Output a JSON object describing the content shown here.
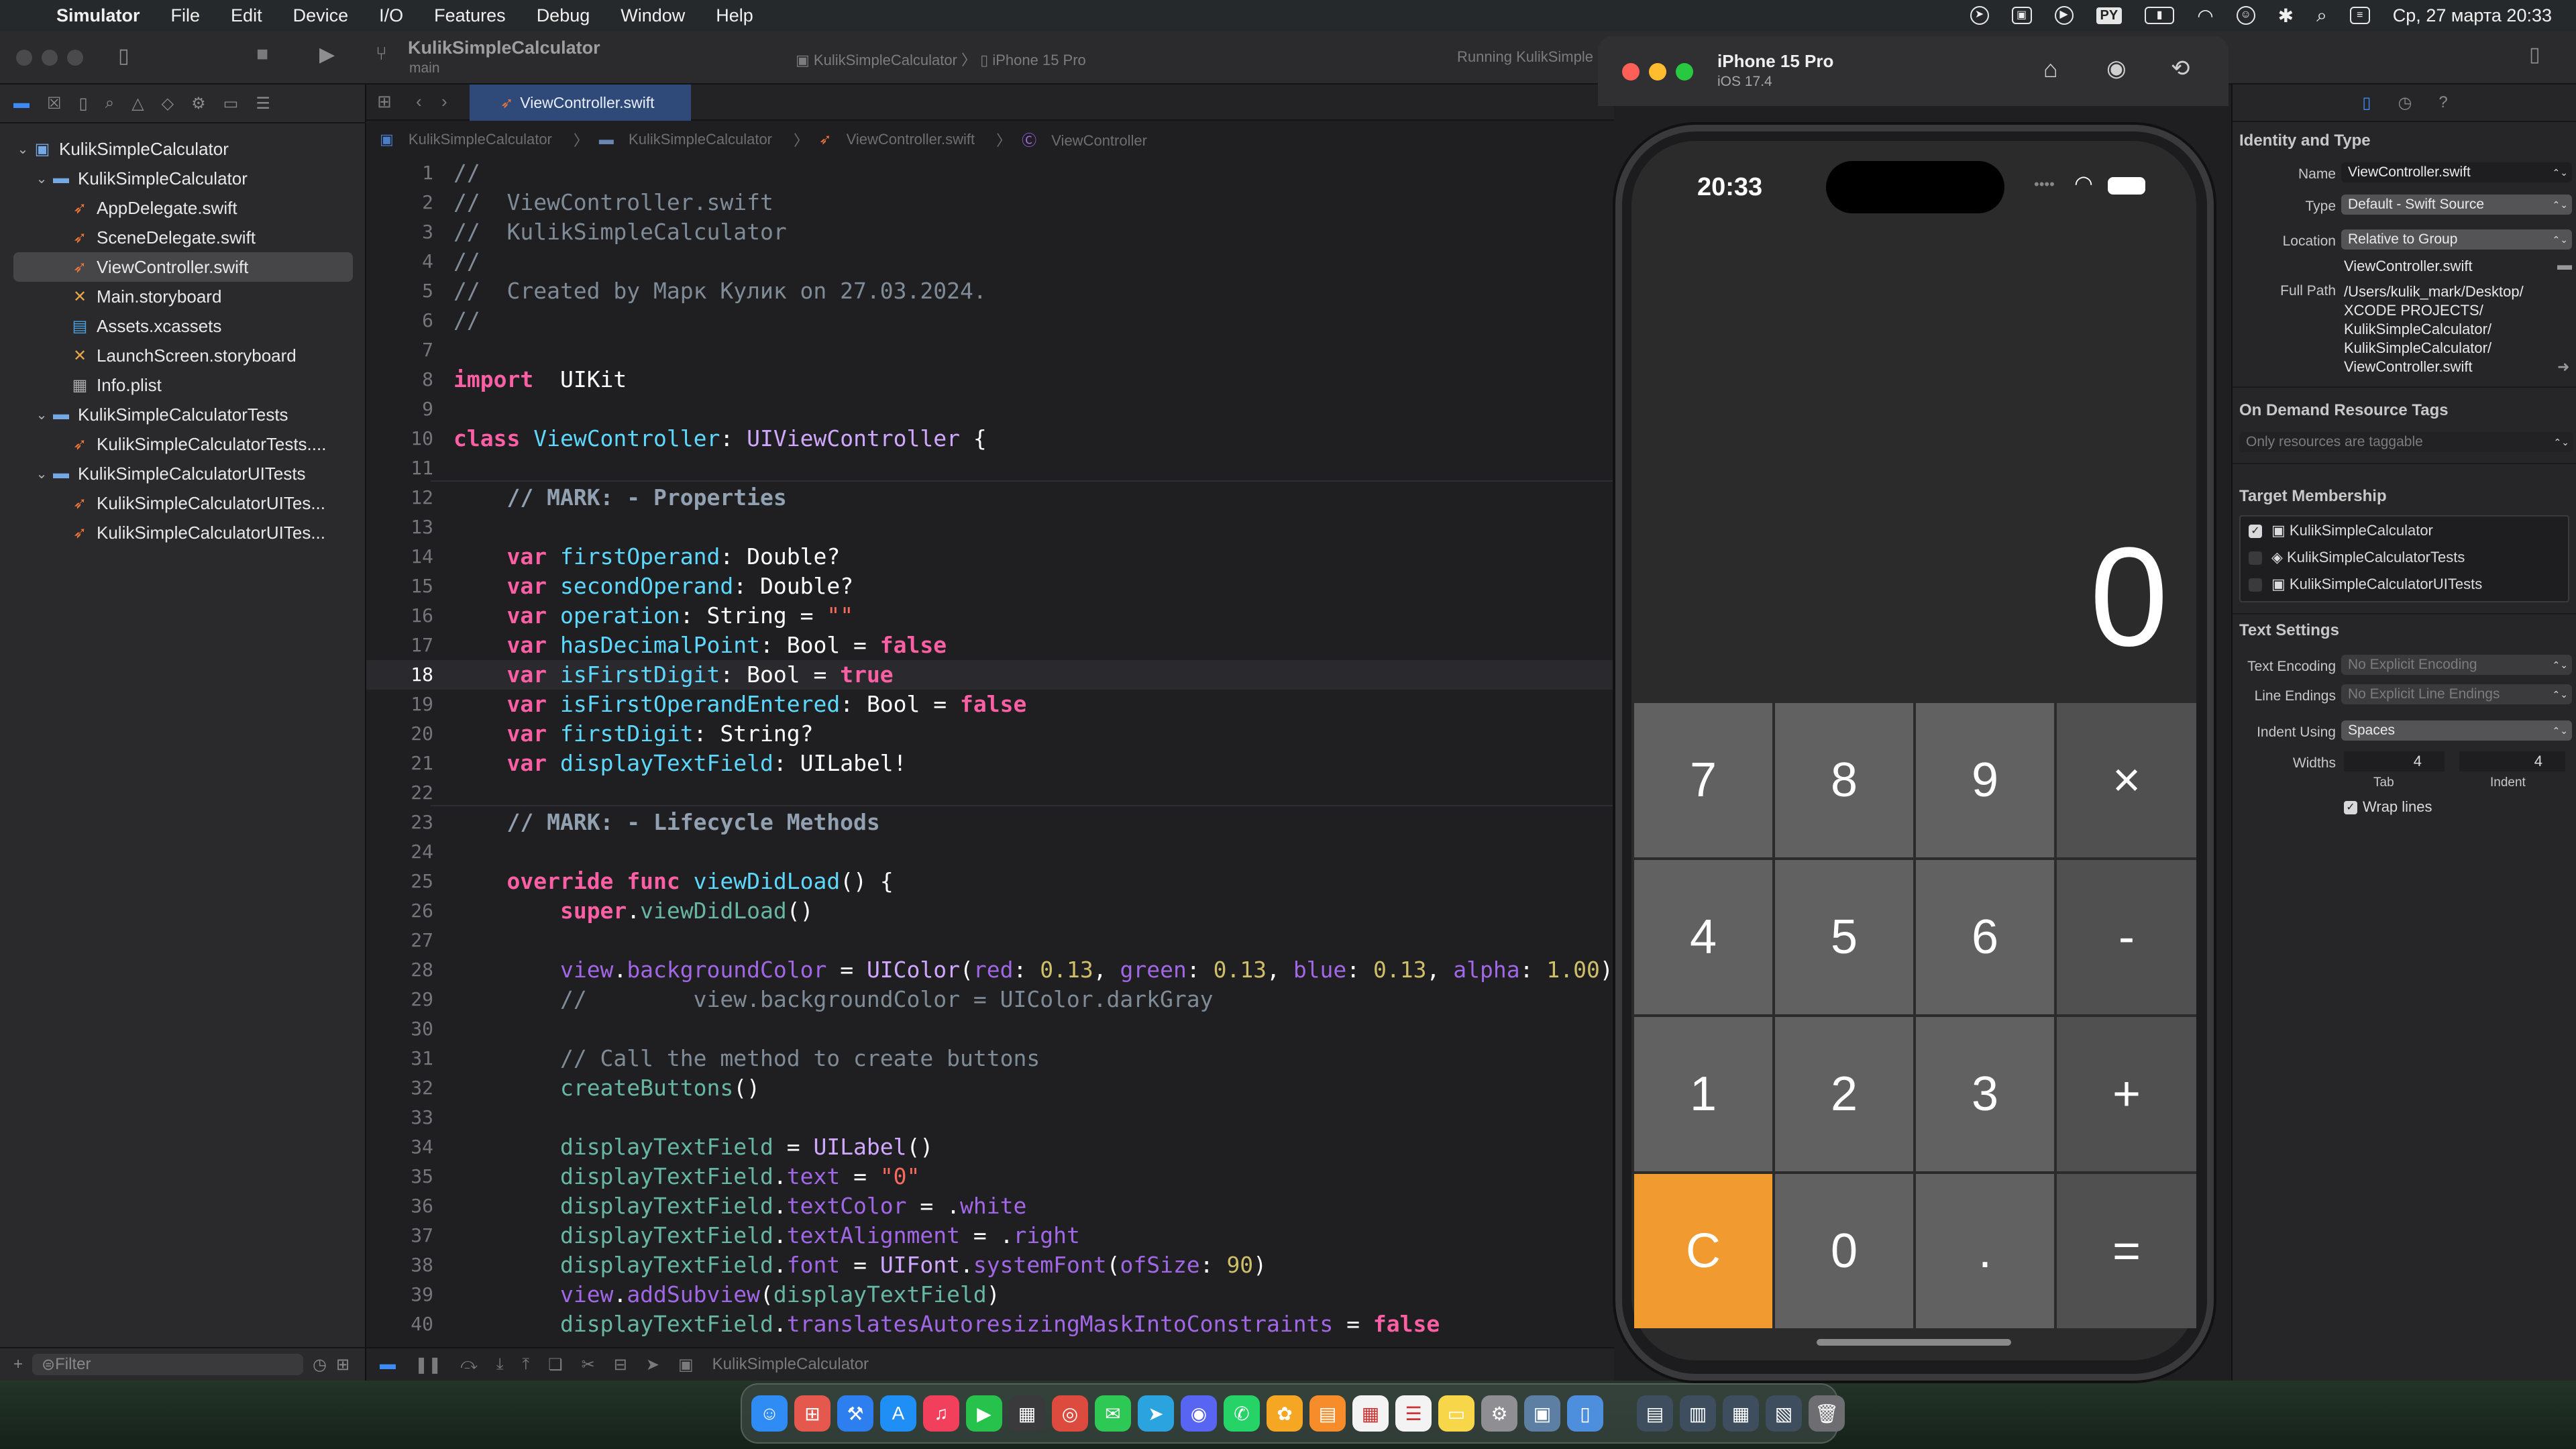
{
  "menubar": {
    "app": "Simulator",
    "items": [
      "File",
      "Edit",
      "Device",
      "I/O",
      "Features",
      "Debug",
      "Window",
      "Help"
    ],
    "lang": "PY",
    "datetime": "Ср, 27 марта 20:33"
  },
  "toolbar": {
    "project": "KulikSimpleCalculator",
    "branch": "main",
    "scheme": "KulikSimpleCalculator",
    "destination": "iPhone 15 Pro",
    "status": "Running KulikSimple"
  },
  "navigator": {
    "items": [
      {
        "label": "KulikSimpleCalculator",
        "indent": 0,
        "kind": "project",
        "chevron": "v"
      },
      {
        "label": "KulikSimpleCalculator",
        "indent": 1,
        "kind": "folder",
        "chevron": "v"
      },
      {
        "label": "AppDelegate.swift",
        "indent": 2,
        "kind": "swift"
      },
      {
        "label": "SceneDelegate.swift",
        "indent": 2,
        "kind": "swift"
      },
      {
        "label": "ViewController.swift",
        "indent": 2,
        "kind": "swift",
        "selected": true
      },
      {
        "label": "Main.storyboard",
        "indent": 2,
        "kind": "sb"
      },
      {
        "label": "Assets.xcassets",
        "indent": 2,
        "kind": "assets"
      },
      {
        "label": "LaunchScreen.storyboard",
        "indent": 2,
        "kind": "sb"
      },
      {
        "label": "Info.plist",
        "indent": 2,
        "kind": "plist"
      },
      {
        "label": "KulikSimpleCalculatorTests",
        "indent": 1,
        "kind": "folder",
        "chevron": "v"
      },
      {
        "label": "KulikSimpleCalculatorTests....",
        "indent": 2,
        "kind": "swift"
      },
      {
        "label": "KulikSimpleCalculatorUITests",
        "indent": 1,
        "kind": "folder",
        "chevron": "v"
      },
      {
        "label": "KulikSimpleCalculatorUITes...",
        "indent": 2,
        "kind": "swift"
      },
      {
        "label": "KulikSimpleCalculatorUITes...",
        "indent": 2,
        "kind": "swift"
      }
    ],
    "filter_placeholder": "Filter"
  },
  "editor": {
    "tab": "ViewController.swift",
    "jump": [
      "KulikSimpleCalculator",
      "KulikSimpleCalculator",
      "ViewController.swift",
      "ViewController"
    ],
    "current_line": 18,
    "lines": [
      [
        [
          "cm",
          "//"
        ]
      ],
      [
        [
          "cm",
          "//  ViewController.swift"
        ]
      ],
      [
        [
          "cm",
          "//  KulikSimpleCalculator"
        ]
      ],
      [
        [
          "cm",
          "//"
        ]
      ],
      [
        [
          "cm",
          "//  Created by Марк Кулик on 27.03.2024."
        ]
      ],
      [
        [
          "cm",
          "//"
        ]
      ],
      [],
      [
        [
          "kw",
          "import"
        ],
        [
          "",
          "  UIKit"
        ]
      ],
      [],
      [
        [
          "kw",
          "class"
        ],
        [
          "",
          " "
        ],
        [
          "dcl",
          "ViewController"
        ],
        [
          "",
          ": "
        ],
        [
          "ty",
          "UIViewController"
        ],
        [
          "",
          " {"
        ]
      ],
      [],
      [
        [
          "",
          "    "
        ],
        [
          "cmk",
          "// MARK: - Properties"
        ]
      ],
      [],
      [
        [
          "",
          "    "
        ],
        [
          "kw",
          "var"
        ],
        [
          "",
          " "
        ],
        [
          "dcl",
          "firstOperand"
        ],
        [
          "",
          ": Double?"
        ]
      ],
      [
        [
          "",
          "    "
        ],
        [
          "kw",
          "var"
        ],
        [
          "",
          " "
        ],
        [
          "dcl",
          "secondOperand"
        ],
        [
          "",
          ": Double?"
        ]
      ],
      [
        [
          "",
          "    "
        ],
        [
          "kw",
          "var"
        ],
        [
          "",
          " "
        ],
        [
          "dcl",
          "operation"
        ],
        [
          "",
          ": String = "
        ],
        [
          "st",
          "\"\""
        ]
      ],
      [
        [
          "",
          "    "
        ],
        [
          "kw",
          "var"
        ],
        [
          "",
          " "
        ],
        [
          "dcl",
          "hasDecimalPoint"
        ],
        [
          "",
          ": Bool = "
        ],
        [
          "kw",
          "false"
        ]
      ],
      [
        [
          "",
          "    "
        ],
        [
          "kw",
          "var"
        ],
        [
          "",
          " "
        ],
        [
          "dcl",
          "isFirstDigit"
        ],
        [
          "",
          ": Bool = "
        ],
        [
          "kw",
          "true"
        ]
      ],
      [
        [
          "",
          "    "
        ],
        [
          "kw",
          "var"
        ],
        [
          "",
          " "
        ],
        [
          "dcl",
          "isFirstOperandEntered"
        ],
        [
          "",
          ": Bool = "
        ],
        [
          "kw",
          "false"
        ]
      ],
      [
        [
          "",
          "    "
        ],
        [
          "kw",
          "var"
        ],
        [
          "",
          " "
        ],
        [
          "dcl",
          "firstDigit"
        ],
        [
          "",
          ": String?"
        ]
      ],
      [
        [
          "",
          "    "
        ],
        [
          "kw",
          "var"
        ],
        [
          "",
          " "
        ],
        [
          "dcl",
          "displayTextField"
        ],
        [
          "",
          ": UILabel!"
        ]
      ],
      [],
      [
        [
          "",
          "    "
        ],
        [
          "cmk",
          "// MARK: - Lifecycle Methods"
        ]
      ],
      [],
      [
        [
          "",
          "    "
        ],
        [
          "kw",
          "override"
        ],
        [
          "",
          " "
        ],
        [
          "kw",
          "func"
        ],
        [
          "",
          " "
        ],
        [
          "dcl",
          "viewDidLoad"
        ],
        [
          "",
          "() {"
        ]
      ],
      [
        [
          "",
          "        "
        ],
        [
          "kw",
          "super"
        ],
        [
          "",
          "."
        ],
        [
          "fn",
          "viewDidLoad"
        ],
        [
          "",
          "()"
        ]
      ],
      [],
      [
        [
          "",
          "        "
        ],
        [
          "pr",
          "view"
        ],
        [
          "",
          "."
        ],
        [
          "pr",
          "backgroundColor"
        ],
        [
          "",
          " = "
        ],
        [
          "ty",
          "UIColor"
        ],
        [
          "",
          "("
        ],
        [
          "pr",
          "red"
        ],
        [
          "",
          ": "
        ],
        [
          "nu",
          "0.13"
        ],
        [
          "",
          ", "
        ],
        [
          "pr",
          "green"
        ],
        [
          "",
          ": "
        ],
        [
          "nu",
          "0.13"
        ],
        [
          "",
          ", "
        ],
        [
          "pr",
          "blue"
        ],
        [
          "",
          ": "
        ],
        [
          "nu",
          "0.13"
        ],
        [
          "",
          ", "
        ],
        [
          "pr",
          "alpha"
        ],
        [
          "",
          ": "
        ],
        [
          "nu",
          "1.00"
        ],
        [
          "",
          ")"
        ]
      ],
      [
        [
          "",
          "        "
        ],
        [
          "cm",
          "//        view.backgroundColor = UIColor.darkGray"
        ]
      ],
      [],
      [
        [
          "",
          "        "
        ],
        [
          "cm",
          "// Call the method to create buttons"
        ]
      ],
      [
        [
          "",
          "        "
        ],
        [
          "fn",
          "createButtons"
        ],
        [
          "",
          "()"
        ]
      ],
      [],
      [
        [
          "",
          "        "
        ],
        [
          "fn",
          "displayTextField"
        ],
        [
          "",
          " = "
        ],
        [
          "ty",
          "UILabel"
        ],
        [
          "",
          "()"
        ]
      ],
      [
        [
          "",
          "        "
        ],
        [
          "fn",
          "displayTextField"
        ],
        [
          "",
          "."
        ],
        [
          "pr",
          "text"
        ],
        [
          "",
          " = "
        ],
        [
          "st",
          "\"0\""
        ]
      ],
      [
        [
          "",
          "        "
        ],
        [
          "fn",
          "displayTextField"
        ],
        [
          "",
          "."
        ],
        [
          "pr",
          "textColor"
        ],
        [
          "",
          " = ."
        ],
        [
          "pr",
          "white"
        ]
      ],
      [
        [
          "",
          "        "
        ],
        [
          "fn",
          "displayTextField"
        ],
        [
          "",
          "."
        ],
        [
          "pr",
          "textAlignment"
        ],
        [
          "",
          " = ."
        ],
        [
          "pr",
          "right"
        ]
      ],
      [
        [
          "",
          "        "
        ],
        [
          "fn",
          "displayTextField"
        ],
        [
          "",
          "."
        ],
        [
          "pr",
          "font"
        ],
        [
          "",
          " = "
        ],
        [
          "ty",
          "UIFont"
        ],
        [
          "",
          "."
        ],
        [
          "pr",
          "systemFont"
        ],
        [
          "",
          "("
        ],
        [
          "pr",
          "ofSize"
        ],
        [
          "",
          ": "
        ],
        [
          "nu",
          "90"
        ],
        [
          "",
          ")"
        ]
      ],
      [
        [
          "",
          "        "
        ],
        [
          "pr",
          "view"
        ],
        [
          "",
          "."
        ],
        [
          "pr",
          "addSubview"
        ],
        [
          "",
          "("
        ],
        [
          "fn",
          "displayTextField"
        ],
        [
          "",
          ")"
        ]
      ],
      [
        [
          "",
          "        "
        ],
        [
          "fn",
          "displayTextField"
        ],
        [
          "",
          "."
        ],
        [
          "pr",
          "translatesAutoresizingMaskIntoConstraints"
        ],
        [
          "",
          " = "
        ],
        [
          "kw",
          "false"
        ]
      ]
    ]
  },
  "inspector": {
    "identity_title": "Identity and Type",
    "name_label": "Name",
    "name_value": "ViewController.swift",
    "type_label": "Type",
    "type_value": "Default - Swift Source",
    "location_label": "Location",
    "location_value": "Relative to Group",
    "location_file": "ViewController.swift",
    "fullpath_label": "Full Path",
    "fullpath": [
      "/Users/kulik_mark/Desktop/",
      "XCODE PROJECTS/",
      "KulikSimpleCalculator/",
      "KulikSimpleCalculator/",
      "ViewController.swift"
    ],
    "odr_title": "On Demand Resource Tags",
    "odr_placeholder": "Only resources are taggable",
    "target_title": "Target Membership",
    "targets": [
      {
        "label": "KulikSimpleCalculator",
        "checked": true
      },
      {
        "label": "KulikSimpleCalculatorTests",
        "checked": false
      },
      {
        "label": "KulikSimpleCalculatorUITests",
        "checked": false
      }
    ],
    "text_title": "Text Settings",
    "encoding_label": "Text Encoding",
    "encoding_value": "No Explicit Encoding",
    "endings_label": "Line Endings",
    "endings_value": "No Explicit Line Endings",
    "indent_label": "Indent Using",
    "indent_value": "Spaces",
    "widths_label": "Widths",
    "tab_value": "4",
    "indent_width_value": "4",
    "tab_label": "Tab",
    "indent_sub_label": "Indent",
    "wrap_label": "Wrap lines"
  },
  "simulator": {
    "device": "iPhone 15 Pro",
    "os": "iOS 17.4",
    "time": "20:33",
    "display": "0",
    "keys": [
      [
        "7",
        "8",
        "9",
        "×"
      ],
      [
        "4",
        "5",
        "6",
        "-"
      ],
      [
        "1",
        "2",
        "3",
        "+"
      ],
      [
        "C",
        "0",
        ".",
        "="
      ]
    ],
    "colors": {
      "digit": "#616161",
      "operator": "#505050",
      "clear": "#f09a30"
    }
  },
  "debug": {
    "target": "KulikSimpleCalculator"
  }
}
